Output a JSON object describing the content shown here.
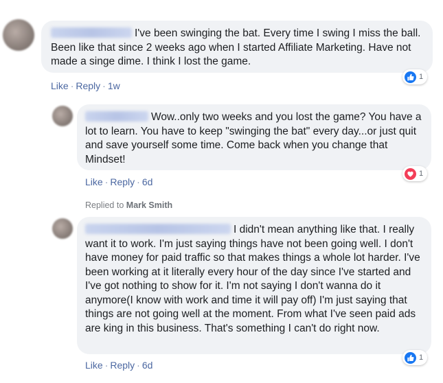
{
  "comments": [
    {
      "text": "I've been swinging the bat. Every time I swing I miss the ball. Been like that since 2 weeks ago when I started Affiliate Marketing. Have not made a singe dime. I think I lost the game.",
      "actions": {
        "like": "Like",
        "reply": "Reply",
        "time": "1w"
      },
      "reaction": {
        "icon": "like-icon",
        "color": "#1877f2",
        "count": "1"
      }
    },
    {
      "text": "Wow..only two weeks and you lost the game? You have a lot to learn. You have to keep \"swinging the bat\" every day...or just quit and save yourself some time. Come back when you change that Mindset!",
      "actions": {
        "like": "Like",
        "reply": "Reply",
        "time": "6d"
      },
      "reaction": {
        "icon": "love-icon",
        "color": "#f33e58",
        "count": "1"
      }
    },
    {
      "text": "I didn't mean anything like that. I really want it to work. I'm just saying things have not been going well. I don't have money for paid traffic so that makes things a whole lot harder. I've been working at it literally every hour of the day since I've started and I've got nothing to show for it. I'm not saying I don't wanna do it anymore(I know with work and time it will pay off) I'm just saying that things are not going well at the moment. From what I've seen paid ads are king in this business. That's something I can't do right now.",
      "actions": {
        "like": "Like",
        "reply": "Reply",
        "time": "6d"
      },
      "reaction": {
        "icon": "like-icon",
        "color": "#1877f2",
        "count": "1"
      }
    }
  ],
  "replied_to": {
    "prefix": "Replied to",
    "name": "Mark Smith"
  },
  "separator": "·"
}
